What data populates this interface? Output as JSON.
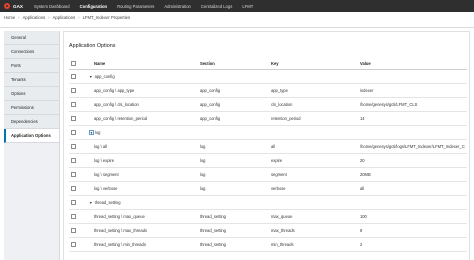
{
  "topbar": {
    "logo_text": "GAX",
    "nav": [
      "System Dashboard",
      "Configuration",
      "Routing Parameters",
      "Administration",
      "Centralized Logs",
      "LFMT"
    ],
    "active_index": 1
  },
  "breadcrumb": [
    "Home",
    "Applications",
    "Applications",
    "LFMT_Indexer Properties"
  ],
  "sidebar": {
    "items": [
      "General",
      "Connections",
      "Ports",
      "Tenants",
      "Options",
      "Permissions",
      "Dependencies",
      "Application Options"
    ],
    "active_index": 7
  },
  "main": {
    "title": "Application Options",
    "columns": {
      "name": "Name",
      "section": "Section",
      "key": "Key",
      "value": "Value"
    },
    "groups": [
      {
        "label": "app_config",
        "rows": [
          {
            "name": "app_config \\ app_type",
            "section": "app_config",
            "key": "app_type",
            "value": "indexer"
          },
          {
            "name": "app_config \\ cls_location",
            "section": "app_config",
            "key": "cls_location",
            "value": "/home/genesys/gcti/LFMT_CLS"
          },
          {
            "name": "app_config \\ retention_period",
            "section": "app_config",
            "key": "retention_period",
            "value": "14"
          }
        ]
      },
      {
        "label": "log",
        "rows": [
          {
            "name": "log \\ all",
            "section": "log",
            "key": "all",
            "value": "/home/genesys/gcti/logs/LFMT_Indexer/LFMT_Indexer_CLS"
          },
          {
            "name": "log \\ expire",
            "section": "log",
            "key": "expire",
            "value": "20"
          },
          {
            "name": "log \\ segment",
            "section": "log",
            "key": "segment",
            "value": "20MB"
          },
          {
            "name": "log \\ verbose",
            "section": "log",
            "key": "verbose",
            "value": "all"
          }
        ]
      },
      {
        "label": "thread_setting",
        "rows": [
          {
            "name": "thread_setting \\ max_queue",
            "section": "thread_setting",
            "key": "max_queue",
            "value": "100"
          },
          {
            "name": "thread_setting \\ max_threads",
            "section": "thread_setting",
            "key": "max_threads",
            "value": "8"
          },
          {
            "name": "thread_setting \\ min_threads",
            "section": "thread_setting",
            "key": "min_threads",
            "value": "2"
          }
        ]
      }
    ]
  }
}
